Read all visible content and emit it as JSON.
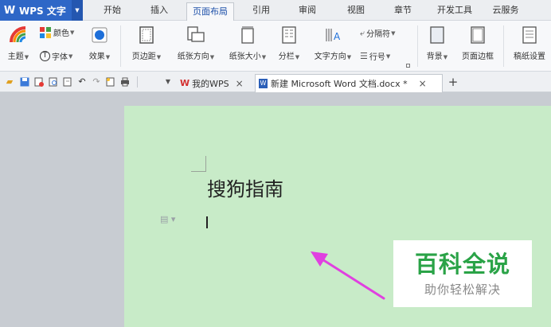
{
  "app": {
    "name": "WPS 文字",
    "logo": "W",
    "dropdown_icon": "triangle-down-icon"
  },
  "menu": {
    "tabs": [
      {
        "label": "开始",
        "active": false
      },
      {
        "label": "插入",
        "active": false
      },
      {
        "label": "页面布局",
        "active": true
      },
      {
        "label": "引用",
        "active": false
      },
      {
        "label": "审阅",
        "active": false
      },
      {
        "label": "视图",
        "active": false
      },
      {
        "label": "章节",
        "active": false
      },
      {
        "label": "开发工具",
        "active": false
      },
      {
        "label": "云服务",
        "active": false
      }
    ]
  },
  "ribbon": {
    "theme": "主题",
    "color": "颜色",
    "font": "字体",
    "effects": "效果",
    "margins": "页边距",
    "orientation": "纸张方向",
    "size": "纸张大小",
    "columns": "分栏",
    "text_direction": "文字方向",
    "separator": "分隔符",
    "line_number": "行号",
    "background": "背景",
    "page_border": "页面边框",
    "paper_setup": "稿纸设置"
  },
  "doc_tabs": [
    {
      "label": "我的WPS",
      "active": false
    },
    {
      "label": "新建 Microsoft Word 文档.docx *",
      "active": true
    }
  ],
  "document": {
    "heading": "搜狗指南"
  },
  "watermark": {
    "title": "百科全说",
    "subtitle": "助你轻松解决"
  },
  "colors": {
    "app_blue": "#2e67c7",
    "page_green": "#c8ebc8",
    "arrow": "#e040e0",
    "watermark_green": "#2aa347",
    "workspace_gray": "#c8ccd2"
  }
}
